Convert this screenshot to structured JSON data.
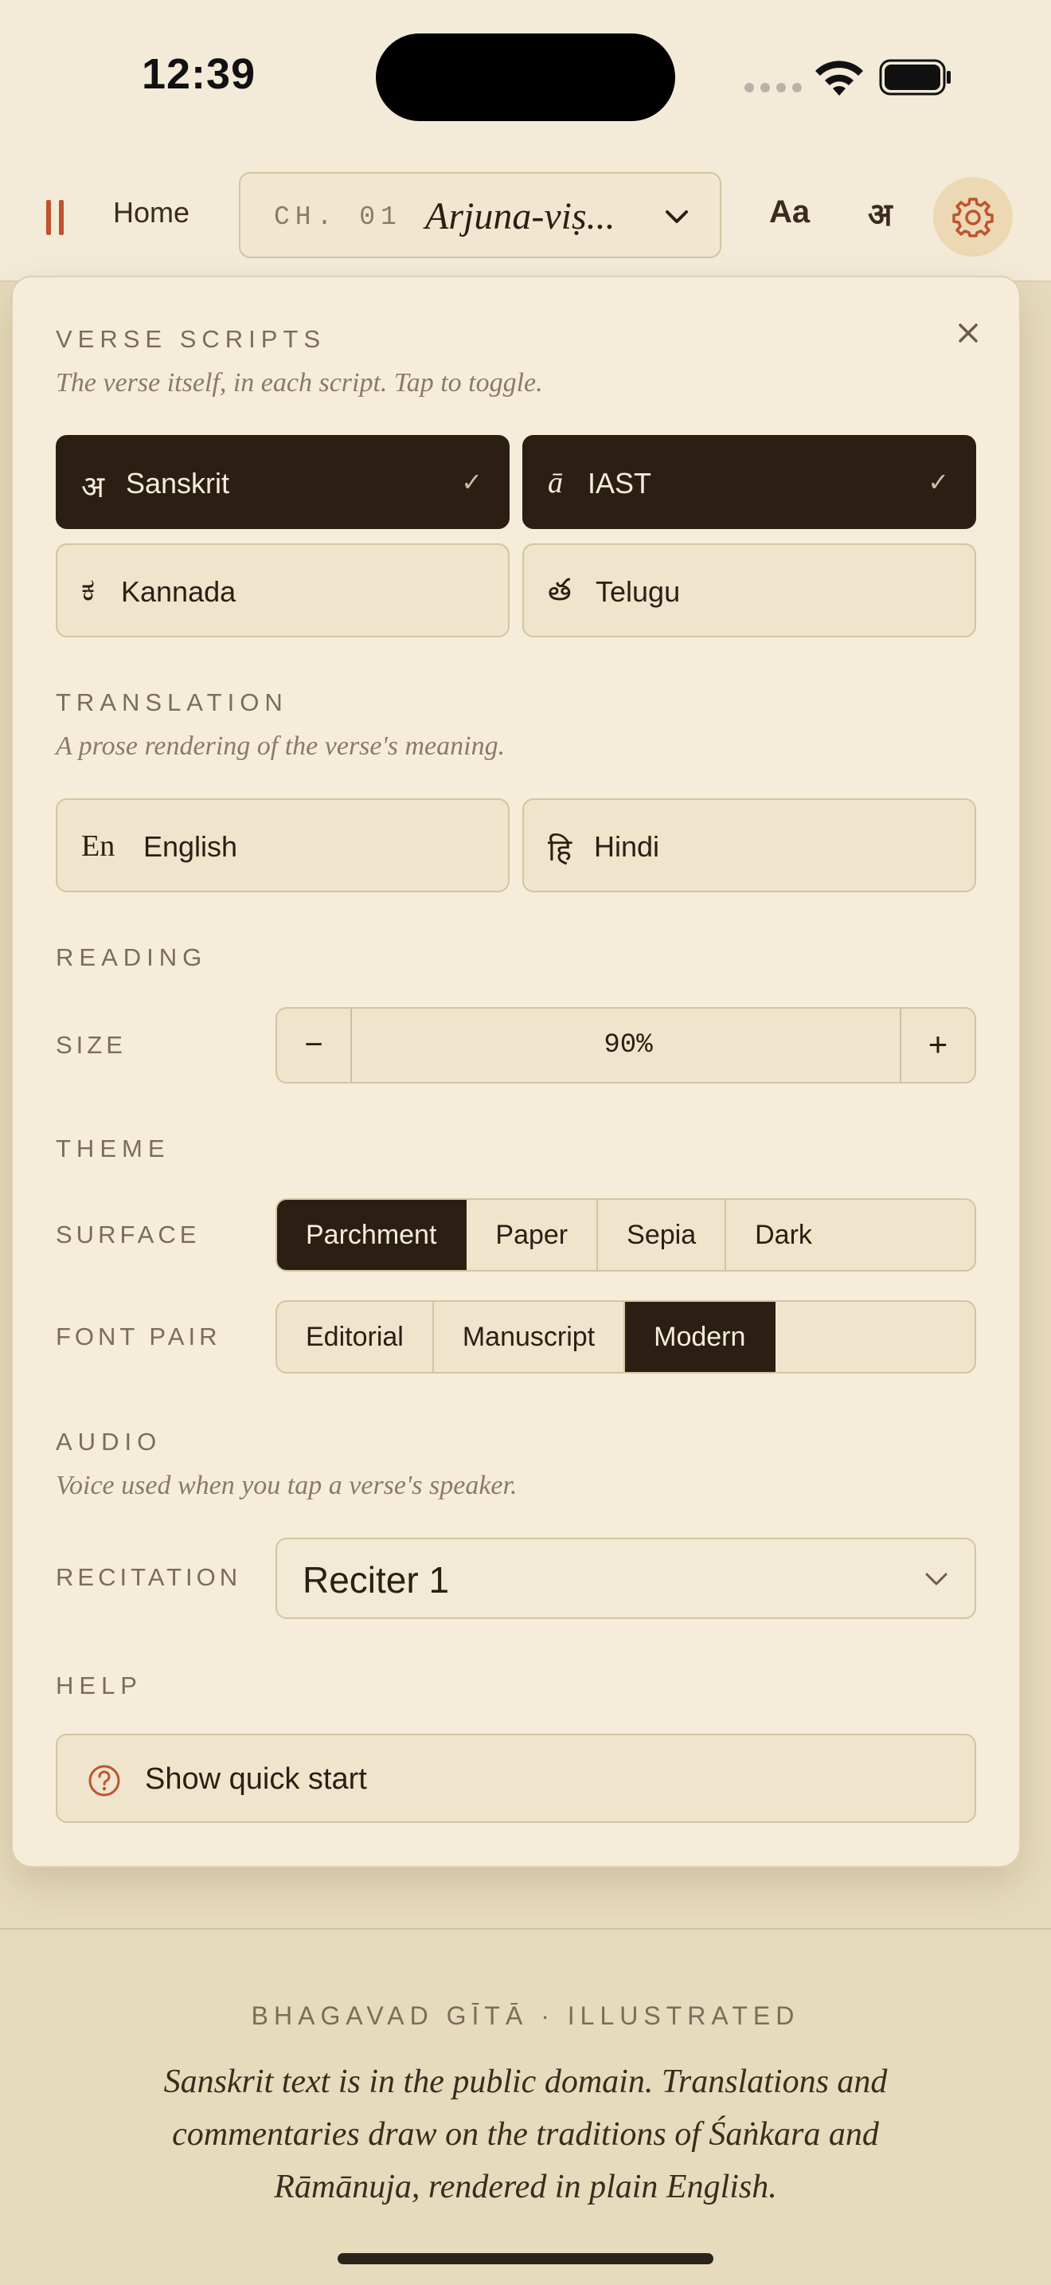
{
  "status_bar": {
    "time": "12:39"
  },
  "topbar": {
    "home_label": "Home",
    "chapter_number": "CH. 01",
    "chapter_name": "Arjuna-viṣ...",
    "font_button": "Aa",
    "script_button": "अ",
    "accent_color": "#c0532f"
  },
  "panel": {
    "verse_scripts": {
      "title": "VERSE SCRIPTS",
      "subtitle": "The verse itself, in each script. Tap to toggle.",
      "options": [
        {
          "glyph": "अ",
          "label": "Sanskrit",
          "selected": true,
          "check": "✓"
        },
        {
          "glyph": "ā",
          "label": "IAST",
          "selected": true,
          "check": "✓"
        },
        {
          "glyph": "ಕ",
          "label": "Kannada",
          "selected": false
        },
        {
          "glyph": "త",
          "label": "Telugu",
          "selected": false
        }
      ]
    },
    "translation": {
      "title": "TRANSLATION",
      "subtitle": "A prose rendering of the verse's meaning.",
      "options": [
        {
          "glyph": "En",
          "label": "English",
          "selected": false
        },
        {
          "glyph": "हि",
          "label": "Hindi",
          "selected": false
        }
      ]
    },
    "reading": {
      "title": "READING",
      "size_label": "SIZE",
      "minus": "−",
      "size_value": "90%",
      "plus": "+"
    },
    "theme": {
      "title": "THEME",
      "surface_label": "SURFACE",
      "surface_options": [
        "Parchment",
        "Paper",
        "Sepia",
        "Dark"
      ],
      "surface_selected": "Parchment",
      "font_pair_label": "FONT PAIR",
      "font_pair_options": [
        "Editorial",
        "Manuscript",
        "Modern"
      ],
      "font_pair_selected": "Modern"
    },
    "audio": {
      "title": "AUDIO",
      "subtitle": "Voice used when you tap a verse's speaker.",
      "recitation_label": "RECITATION",
      "recitation_value": "Reciter 1"
    },
    "help": {
      "title": "HELP",
      "quick_start_label": "Show quick start"
    }
  },
  "footer": {
    "title": "BHAGAVAD GĪTĀ · ILLUSTRATED",
    "text": "Sanskrit text is in the public domain. Translations and commentaries draw on the traditions of Śaṅkara and Rāmānuja, rendered in plain English."
  }
}
